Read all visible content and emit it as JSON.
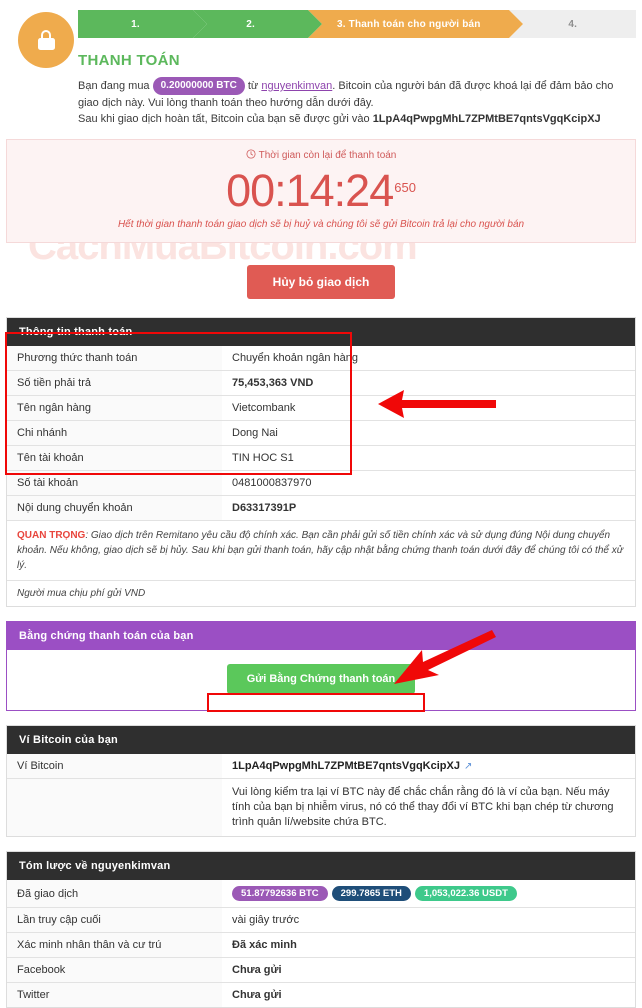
{
  "watermark": "CachMuaBitcoin.com",
  "steps": [
    {
      "label": "1.",
      "state": "done"
    },
    {
      "label": "2.",
      "state": "done"
    },
    {
      "label": "3. Thanh toán cho người bán",
      "state": "active"
    },
    {
      "label": "4.",
      "state": "pending"
    }
  ],
  "header": {
    "lock_icon": "lock-icon",
    "title": "THANH TOÁN",
    "intro_pre": "Bạn đang mua",
    "amount_badge": "0.20000000 BTC",
    "intro_from": "từ",
    "seller": "nguyenkimvan",
    "intro_rest": ". Bitcoin của người bán đã được khoá lại để đảm bảo cho giao dịch này. Vui lòng thanh toán theo hướng dẫn dưới đây.",
    "line2_pre": "Sau khi giao dịch hoàn tất, Bitcoin của bạn sẽ được gửi vào",
    "line2_address": "1LpA4qPwpgMhL7ZPMtBE7qntsVgqKcipXJ"
  },
  "countdown": {
    "clock_icon": "clock-icon",
    "label": "Thời gian còn lại để thanh toán",
    "time": "00:14:24",
    "millis": "650",
    "note": "Hết thời gian thanh toán giao dịch sẽ bị huỷ và chúng tôi sẽ gửi Bitcoin trả lại cho người bán"
  },
  "cancel_button": "Hủy bỏ giao dịch",
  "payment_info": {
    "title": "Thông tin thanh toán",
    "rows": [
      {
        "key": "Phương thức thanh toán",
        "value": "Chuyển khoản ngân hàng",
        "style": "normal"
      },
      {
        "key": "Số tiền phải trả",
        "value": "75,453,363 VND",
        "style": "green"
      },
      {
        "key": "Tên ngân hàng",
        "value": "Vietcombank",
        "style": "normal"
      },
      {
        "key": "Chi nhánh",
        "value": "Dong Nai",
        "style": "normal"
      },
      {
        "key": "Tên tài khoản",
        "value": "TIN HOC S1",
        "style": "normal"
      },
      {
        "key": "Số tài khoản",
        "value": "0481000837970",
        "style": "normal"
      },
      {
        "key": "Nội dung chuyển khoản",
        "value": "D63317391P",
        "style": "bold"
      }
    ],
    "important_label": "QUAN TRỌNG",
    "important_text": ": Giao dịch trên Remitano yêu cầu độ chính xác. Bạn cần phải gửi số tiền chính xác và sử dụng đúng Nội dung chuyển khoản. Nếu không, giao dịch sẽ bị hủy. Sau khi bạn gửi thanh toán, hãy cập nhật bằng chứng thanh toán dưới đây để chúng tôi có thể xử lý.",
    "fee_note": "Người mua chịu phí gửi VND"
  },
  "proof": {
    "title": "Bằng chứng thanh toán của bạn",
    "button": "Gửi Bằng Chứng thanh toán"
  },
  "wallet": {
    "title": "Ví Bitcoin của bạn",
    "row_key": "Ví Bitcoin",
    "address": "1LpA4qPwpgMhL7ZPMtBE7qntsVgqKcipXJ",
    "external_link_icon": "external-link-icon",
    "warning": "Vui lòng kiểm tra lại ví BTC này để chắc chắn rằng đó là ví của bạn. Nếu máy tính của bạn bị nhiễm virus, nó có thể thay đổi ví BTC khi bạn chép từ chương trình quản lí/website chứa BTC."
  },
  "summary": {
    "title": "Tóm lược về nguyenkimvan",
    "rows": [
      {
        "key": "Đã giao dịch",
        "value": "",
        "style": "pills"
      },
      {
        "key": "Lần truy cập cuối",
        "value": "vài giây trước",
        "style": "normal"
      },
      {
        "key": "Xác minh nhân thân và cư trú",
        "value": "Đã xác minh",
        "style": "bold"
      },
      {
        "key": "Facebook",
        "value": "Chưa gửi",
        "style": "bold"
      },
      {
        "key": "Twitter",
        "value": "Chưa gửi",
        "style": "bold"
      }
    ],
    "pills": [
      {
        "label": "51.87792636 BTC",
        "kind": "btc"
      },
      {
        "label": "299.7865 ETH",
        "kind": "eth"
      },
      {
        "label": "1,053,022.36 USDT",
        "kind": "usdt"
      }
    ]
  },
  "annotations": {
    "arrow_payment": "red-arrow-left",
    "arrow_wallet": "red-arrow-diagonal",
    "box_payment": "red-highlight-box",
    "box_wallet": "red-highlight-box"
  },
  "colors": {
    "green": "#5cb85c",
    "orange": "#efab4d",
    "purple": "#9b4fc4",
    "red": "#d9534f",
    "annotation_red": "#f00808"
  }
}
